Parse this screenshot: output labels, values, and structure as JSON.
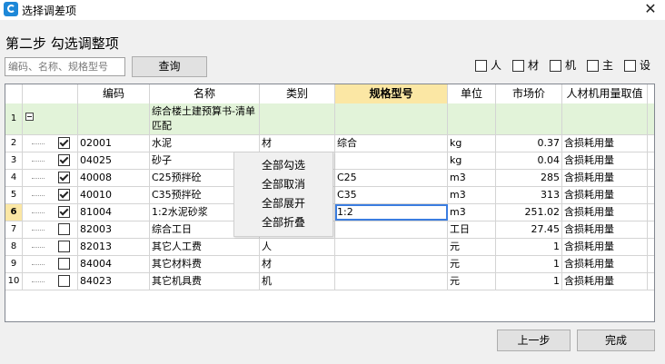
{
  "window": {
    "title": "选择调差项",
    "close": "✕"
  },
  "step_title": "第二步 勾选调整项",
  "search": {
    "placeholder": "编码、名称、规格型号",
    "value": "",
    "button": "查询"
  },
  "filters": [
    {
      "label": "人",
      "checked": false
    },
    {
      "label": "材",
      "checked": false
    },
    {
      "label": "机",
      "checked": false
    },
    {
      "label": "主",
      "checked": false
    },
    {
      "label": "设",
      "checked": false
    }
  ],
  "table": {
    "headers": [
      "编码",
      "名称",
      "类别",
      "规格型号",
      "单位",
      "市场价",
      "人材机用量取值"
    ],
    "group": {
      "num": "1",
      "name": "综合楼土建预算书-清单匹配"
    },
    "rows": [
      {
        "num": "2",
        "checked": true,
        "code": "02001",
        "name": "水泥",
        "type": "材",
        "spec": "综合",
        "unit": "kg",
        "price": "0.37",
        "qty": "含损耗用量"
      },
      {
        "num": "3",
        "checked": true,
        "code": "04025",
        "name": "砂子",
        "type": "",
        "spec": "",
        "unit": "kg",
        "price": "0.04",
        "qty": "含损耗用量"
      },
      {
        "num": "4",
        "checked": true,
        "code": "40008",
        "name": "C25预拌砼",
        "type": "",
        "spec": "C25",
        "unit": "m3",
        "price": "285",
        "qty": "含损耗用量"
      },
      {
        "num": "5",
        "checked": true,
        "code": "40010",
        "name": "C35预拌砼",
        "type": "",
        "spec": "C35",
        "unit": "m3",
        "price": "313",
        "qty": "含损耗用量"
      },
      {
        "num": "6",
        "checked": true,
        "code": "81004",
        "name": "1:2水泥砂浆",
        "type": "",
        "spec": "1:2",
        "unit": "m3",
        "price": "251.02",
        "qty": "含损耗用量"
      },
      {
        "num": "7",
        "checked": false,
        "code": "82003",
        "name": "综合工日",
        "type": "",
        "spec": "",
        "unit": "工日",
        "price": "27.45",
        "qty": "含损耗用量"
      },
      {
        "num": "8",
        "checked": false,
        "code": "82013",
        "name": "其它人工费",
        "type": "人",
        "spec": "",
        "unit": "元",
        "price": "1",
        "qty": "含损耗用量"
      },
      {
        "num": "9",
        "checked": false,
        "code": "84004",
        "name": "其它材料费",
        "type": "材",
        "spec": "",
        "unit": "元",
        "price": "1",
        "qty": "含损耗用量"
      },
      {
        "num": "10",
        "checked": false,
        "code": "84023",
        "name": "其它机具费",
        "type": "机",
        "spec": "",
        "unit": "元",
        "price": "1",
        "qty": "含损耗用量"
      }
    ]
  },
  "context_menu": [
    "全部勾选",
    "全部取消",
    "全部展开",
    "全部折叠"
  ],
  "footer": {
    "prev": "上一步",
    "done": "完成"
  },
  "colors": {
    "header_highlight": "#fbe7a4",
    "group_row": "#e2f3d9",
    "edit_border": "#3b7de0"
  }
}
